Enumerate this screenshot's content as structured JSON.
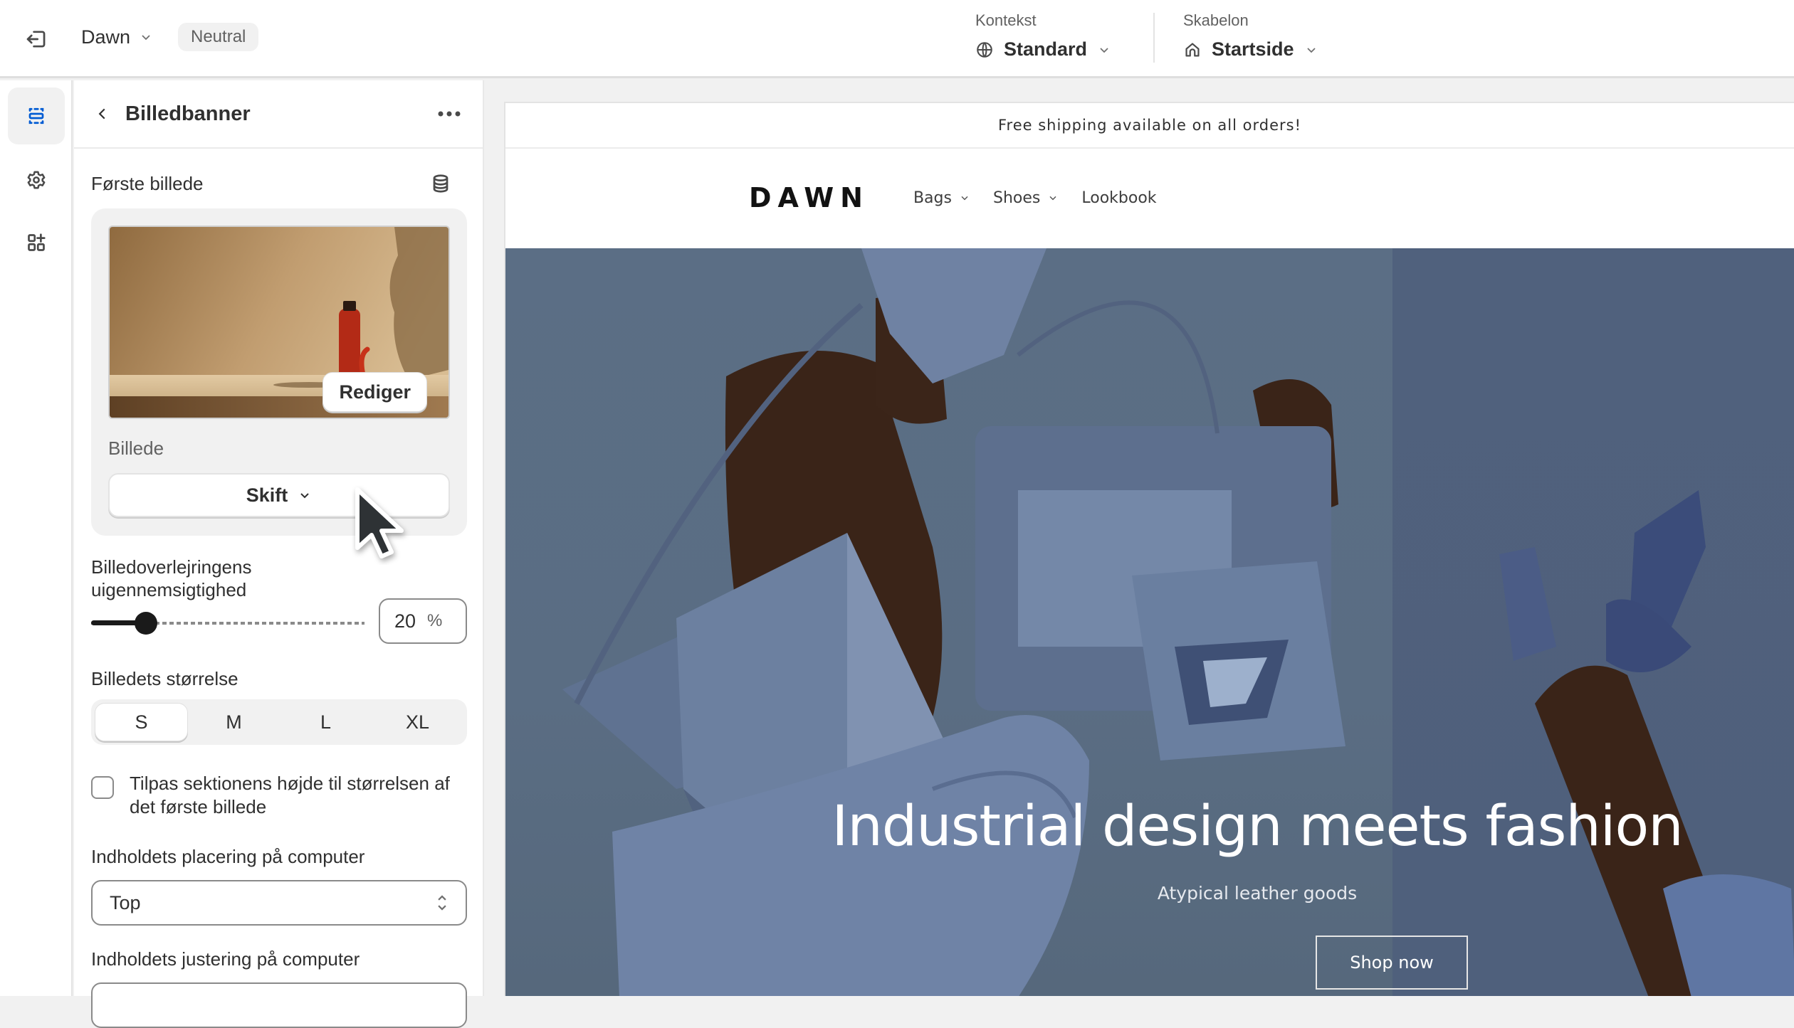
{
  "topbar": {
    "theme_name": "Dawn",
    "theme_badge": "Neutral",
    "context_label": "Kontekst",
    "context_value": "Standard",
    "template_label": "Skabelon",
    "template_value": "Startside"
  },
  "rail": {
    "items": [
      {
        "icon": "sections-icon",
        "active": true
      },
      {
        "icon": "gear-icon",
        "active": false
      },
      {
        "icon": "apps-add-icon",
        "active": false
      }
    ]
  },
  "panel": {
    "title": "Billedbanner",
    "first_image_label": "Første billede",
    "edit_button": "Rediger",
    "image_sublabel": "Billede",
    "swap_button": "Skift",
    "overlay_label_line1": "Billedoverlejringens",
    "overlay_label_line2": "uigennemsigtighed",
    "overlay_opacity": {
      "value": 20,
      "min": 0,
      "max": 100,
      "unit": "%"
    },
    "size_label": "Billedets størrelse",
    "size_options": [
      "S",
      "M",
      "L",
      "XL"
    ],
    "size_selected": "S",
    "fit_checkbox_label": "Tilpas sektionens højde til størrelsen af det første billede",
    "fit_checkbox_checked": false,
    "position_label": "Indholdets placering på computer",
    "position_value": "Top",
    "alignment_label": "Indholdets justering på computer"
  },
  "preview": {
    "announcement": "Free shipping available on all orders!",
    "logo": "DAWN",
    "nav": [
      {
        "label": "Bags",
        "has_dropdown": true
      },
      {
        "label": "Shoes",
        "has_dropdown": true
      },
      {
        "label": "Lookbook",
        "has_dropdown": false
      }
    ],
    "hero_title": "Industrial design meets fashion",
    "hero_subtitle": "Atypical leather goods",
    "hero_button": "Shop now"
  },
  "colors": {
    "accent": "#005bd3",
    "text": "#303030",
    "muted": "#616161",
    "surface": "#f1f1f1"
  }
}
